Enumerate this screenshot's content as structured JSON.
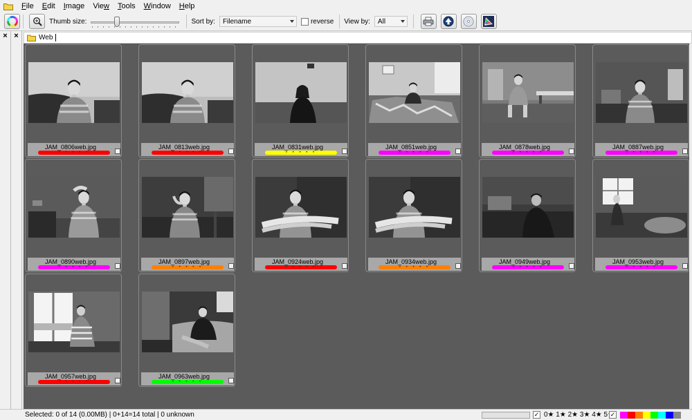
{
  "menu": {
    "items": [
      "File",
      "Edit",
      "Image",
      "View",
      "Tools",
      "Window",
      "Help"
    ]
  },
  "toolbar": {
    "thumb_size_label": "Thumb size:",
    "thumb_size_level": 0.28,
    "sort_by_label": "Sort by:",
    "sort_by_value": "Filename",
    "reverse_label": "reverse",
    "view_by_label": "View by:",
    "view_by_value": "All"
  },
  "pathbar": {
    "path": "Web"
  },
  "thumbnails": [
    {
      "filename": "JAM_0806web.jpg",
      "label_color": "#ff0000",
      "stars": "• • • • •",
      "photo": "boy-sofa-closeup"
    },
    {
      "filename": "JAM_0813web.jpg",
      "label_color": "#ff0000",
      "stars": "• • • • •",
      "photo": "boy-sofa-closeup"
    },
    {
      "filename": "JAM_0831web.jpg",
      "label_color": "#ffff00",
      "stars": "• • • • •",
      "photo": "girl-smoking-room"
    },
    {
      "filename": "JAM_0851web.jpg",
      "label_color": "#ff00ff",
      "stars": "• • • • •",
      "photo": "boy-cluttered-room"
    },
    {
      "filename": "JAM_0878web.jpg",
      "label_color": "#ff00ff",
      "stars": "• • • • •",
      "photo": "boy-kitchen-chair"
    },
    {
      "filename": "JAM_0887web.jpg",
      "label_color": "#ff00ff",
      "stars": "• • • • •",
      "photo": "boy-kitchen-portrait"
    },
    {
      "filename": "JAM_0890web.jpg",
      "label_color": "#ff00ff",
      "stars": "• • • • •",
      "photo": "boy-hand-head"
    },
    {
      "filename": "JAM_0897web.jpg",
      "label_color": "#ff8000",
      "stars": "• • • • •",
      "photo": "boy-smoking-table"
    },
    {
      "filename": "JAM_0924web.jpg",
      "label_color": "#ff0000",
      "stars": "• • • • •",
      "photo": "boy-arms-crossed"
    },
    {
      "filename": "JAM_0934web.jpg",
      "label_color": "#ff8000",
      "stars": "• • • • •",
      "photo": "boy-arms-crossed"
    },
    {
      "filename": "JAM_0949web.jpg",
      "label_color": "#ff00ff",
      "stars": "• • • • •",
      "photo": "boy-dark-kitchen"
    },
    {
      "filename": "JAM_0953web.jpg",
      "label_color": "#ff00ff",
      "stars": "• • • • •",
      "photo": "boy-window-room"
    },
    {
      "filename": "JAM_0957web.jpg",
      "label_color": "#ff0000",
      "stars": "• • • • •",
      "photo": "boy-window-bright"
    },
    {
      "filename": "JAM_0963web.jpg",
      "label_color": "#00ff00",
      "stars": "• • • • •",
      "photo": "boy-sofa-room"
    }
  ],
  "statusbar": {
    "text": "Selected: 0 of 14 (0.00MB) | 0+14=14 total | 0 unknown",
    "rating_filter": "0★ 1★ 2★ 3★ 4★ 5★",
    "color_swatches": [
      "#ff00ff",
      "#ff0000",
      "#ff8000",
      "#ffff00",
      "#00ff00",
      "#00ffff",
      "#0000ff",
      "#888888"
    ]
  }
}
